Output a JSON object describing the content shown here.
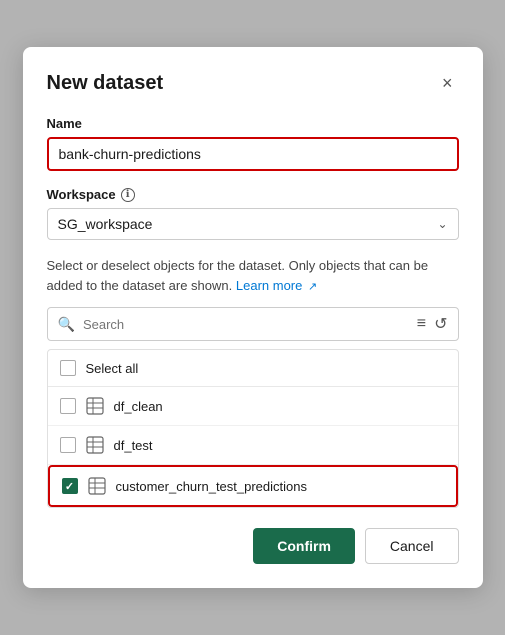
{
  "modal": {
    "title": "New dataset",
    "close_label": "×"
  },
  "name_field": {
    "label": "Name",
    "value": "bank-churn-predictions",
    "placeholder": "bank-churn-predictions"
  },
  "workspace_field": {
    "label": "Workspace",
    "info_icon": "ℹ",
    "selected_value": "SG_workspace"
  },
  "description": {
    "text": "Select or deselect objects for the dataset. Only objects that can be added to the dataset are shown.",
    "learn_more_label": "Learn more",
    "external_link": "↗"
  },
  "search": {
    "placeholder": "Search",
    "filter_icon": "≡",
    "refresh_icon": "↺"
  },
  "items": [
    {
      "id": "select-all",
      "label": "Select all",
      "checked": false,
      "type": "header"
    },
    {
      "id": "df_clean",
      "label": "df_clean",
      "checked": false,
      "type": "table"
    },
    {
      "id": "df_test",
      "label": "df_test",
      "checked": false,
      "type": "table"
    },
    {
      "id": "customer_churn_test_predictions",
      "label": "customer_churn_test_predictions",
      "checked": true,
      "type": "table"
    }
  ],
  "footer": {
    "confirm_label": "Confirm",
    "cancel_label": "Cancel"
  }
}
